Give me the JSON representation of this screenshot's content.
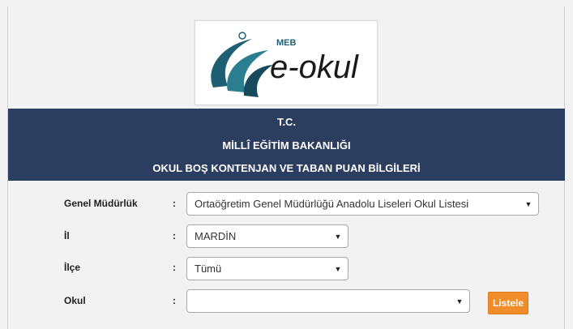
{
  "logo": {
    "brand_small": "MEB",
    "brand_main": "e-okul"
  },
  "banner": {
    "line1": "T.C.",
    "line2": "MİLLÎ EĞİTİM BAKANLIĞI",
    "line3": "OKUL BOŞ KONTENJAN VE TABAN PUAN BİLGİLERİ"
  },
  "form": {
    "colon": ":",
    "genel_mudurluk": {
      "label": "Genel Müdürlük",
      "value": "Ortaöğretim Genel Müdürlüğü Anadolu Liseleri Okul Listesi"
    },
    "il": {
      "label": "İl",
      "value": "MARDİN"
    },
    "ilce": {
      "label": "İlçe",
      "value": "Tümü"
    },
    "okul": {
      "label": "Okul",
      "value": ""
    },
    "list_button": "Listele"
  },
  "colors": {
    "banner": "#2c3e5f",
    "button": "#f08c2a",
    "logo_teal": "#1f5f73"
  },
  "icons": {
    "dropdown": "dropdown-arrow-icon",
    "logo": "e-okul-logo-icon"
  }
}
